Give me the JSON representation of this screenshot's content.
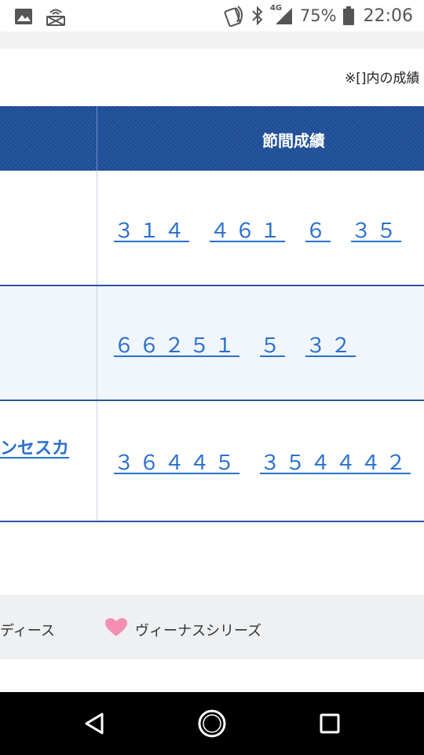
{
  "status_bar": {
    "battery": "75%",
    "time": "22:06",
    "network": "4G"
  },
  "note": "※[]内の成績",
  "table": {
    "header": "節間成績",
    "rows": [
      {
        "name": "",
        "scores": [
          "３１４",
          "４６１",
          "６",
          "３５"
        ],
        "bg": "#ffffff"
      },
      {
        "name": "",
        "scores": [
          "６６２５１",
          "５",
          "３２"
        ],
        "bg": "#f1f6fc"
      },
      {
        "name": "ンセスカ",
        "scores": [
          "３６４４５",
          "３５４４４２"
        ],
        "bg": "#ffffff"
      }
    ]
  },
  "footer": {
    "left_label": "ディース",
    "right_label": "ヴィーナスシリーズ"
  },
  "colors": {
    "header_blue": "#1e4f9a",
    "link_blue": "#2a6fce",
    "heart_pink": "#f58fb2"
  }
}
